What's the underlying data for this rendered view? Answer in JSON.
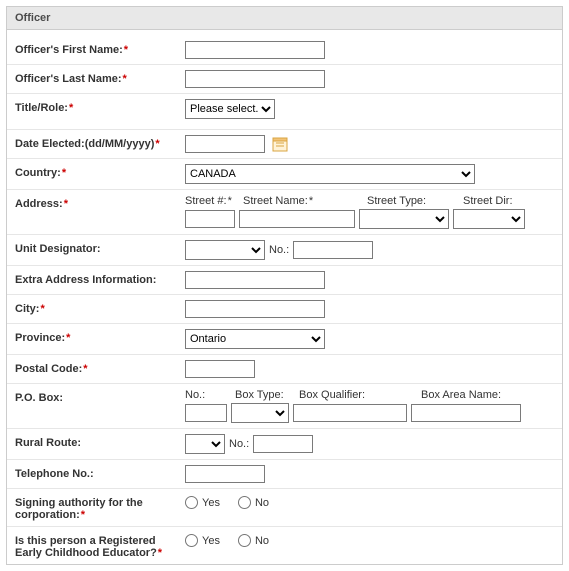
{
  "panel": {
    "title": "Officer"
  },
  "labels": {
    "first_name": "Officer's First Name:",
    "last_name": "Officer's Last Name:",
    "title_role": "Title/Role:",
    "date_elected": "Date Elected:(dd/MM/yyyy)",
    "country": "Country:",
    "address": "Address:",
    "unit_designator": "Unit Designator:",
    "extra_address": "Extra Address Information:",
    "city": "City:",
    "province": "Province:",
    "postal_code": "Postal Code:",
    "po_box": "P.O. Box:",
    "rural_route": "Rural Route:",
    "telephone": "Telephone No.:",
    "signing_authority": "Signing authority for the corporation:",
    "is_rece": "Is this person a Registered Early Childhood Educator?"
  },
  "sublabels": {
    "street_no": "Street #:",
    "street_name": "Street Name:",
    "street_type": "Street Type:",
    "street_dir": "Street Dir:",
    "no": "No.:",
    "box_type": "Box Type:",
    "box_qualifier": "Box Qualifier:",
    "box_area_name": "Box Area Name:"
  },
  "values": {
    "first_name": "",
    "last_name": "",
    "title_role": "Please select...",
    "date_elected": "",
    "country": "CANADA",
    "street_no": "",
    "street_name": "",
    "street_type": "",
    "street_dir": "",
    "unit_designator": "",
    "unit_no": "",
    "extra_address": "",
    "city": "",
    "province": "Ontario",
    "postal_code": "",
    "po_no": "",
    "po_box_type": "",
    "po_box_qualifier": "",
    "po_box_area_name": "",
    "rural_route": "",
    "rural_no": "",
    "telephone": ""
  },
  "options": {
    "yes": "Yes",
    "no": "No"
  },
  "req_marker": "*"
}
